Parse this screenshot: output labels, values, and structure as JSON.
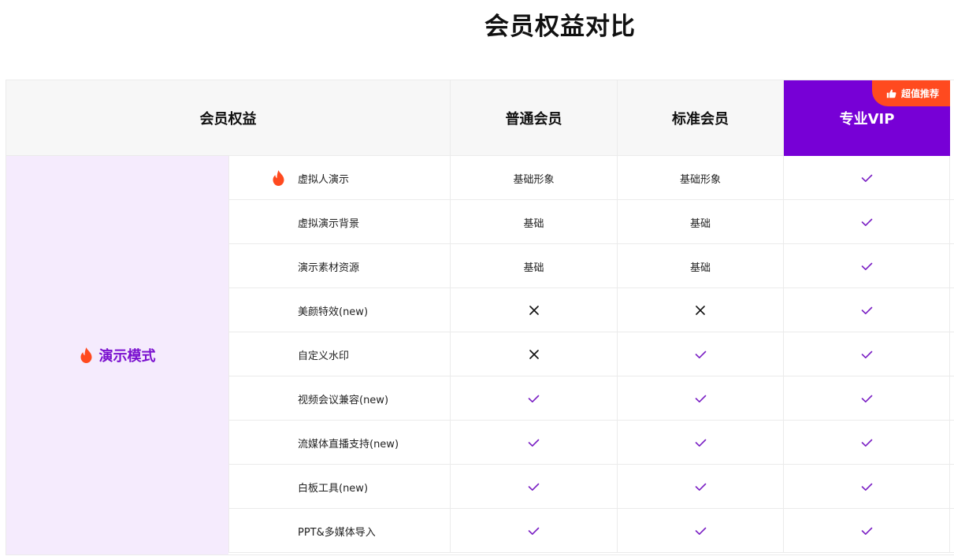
{
  "page": {
    "title": "会员权益对比"
  },
  "header": {
    "benefit": "会员权益",
    "normal": "普通会员",
    "standard": "标准会员",
    "pro": "专业VIP",
    "pro_badge": "超值推荐"
  },
  "category": {
    "label": "演示模式",
    "icon": "flame-icon"
  },
  "rows": [
    {
      "name": "虚拟人演示",
      "hot": true,
      "normal": "基础形象",
      "standard": "基础形象",
      "pro": "check"
    },
    {
      "name": "虚拟演示背景",
      "hot": false,
      "normal": "基础",
      "standard": "基础",
      "pro": "check"
    },
    {
      "name": "演示素材资源",
      "hot": false,
      "normal": "基础",
      "standard": "基础",
      "pro": "check"
    },
    {
      "name": "美颜特效(new)",
      "hot": false,
      "normal": "cross",
      "standard": "cross",
      "pro": "check"
    },
    {
      "name": "自定义水印",
      "hot": false,
      "normal": "cross",
      "standard": "check",
      "pro": "check"
    },
    {
      "name": "视频会议兼容(new)",
      "hot": false,
      "normal": "check",
      "standard": "check",
      "pro": "check"
    },
    {
      "name": "流媒体直播支持(new)",
      "hot": false,
      "normal": "check",
      "standard": "check",
      "pro": "check"
    },
    {
      "name": "白板工具(new)",
      "hot": false,
      "normal": "check",
      "standard": "check",
      "pro": "check"
    },
    {
      "name": "PPT&多媒体导入",
      "hot": false,
      "normal": "check",
      "standard": "check",
      "pro": "check"
    }
  ],
  "colors": {
    "accent": "#7700d6",
    "check": "#7a1fc4",
    "badge": "#ff4a1f",
    "category_bg": "#f5ebfd",
    "flame": "#ff4a1f"
  }
}
